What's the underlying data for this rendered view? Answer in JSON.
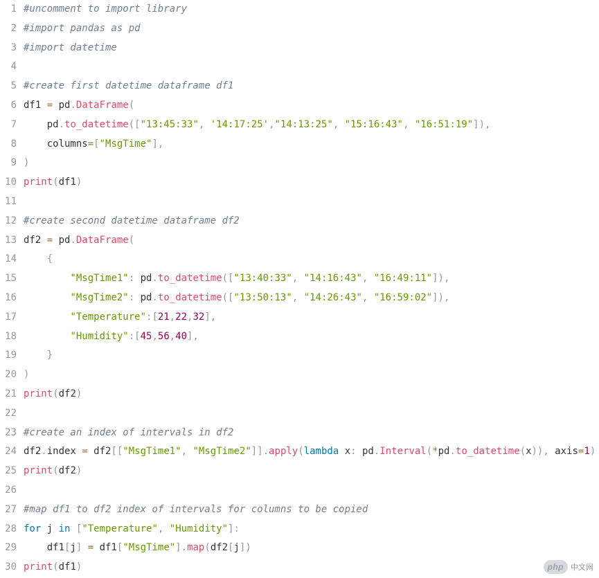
{
  "code": {
    "lines": [
      {
        "n": 1,
        "tokens": [
          {
            "c": "comment",
            "t": "#uncomment to import library"
          }
        ]
      },
      {
        "n": 2,
        "tokens": [
          {
            "c": "comment",
            "t": "#import pandas as pd"
          }
        ]
      },
      {
        "n": 3,
        "tokens": [
          {
            "c": "comment",
            "t": "#import datetime"
          }
        ]
      },
      {
        "n": 4,
        "tokens": [
          {
            "c": "ident",
            "t": " "
          }
        ]
      },
      {
        "n": 5,
        "tokens": [
          {
            "c": "comment",
            "t": "#create first datetime dataframe df1"
          }
        ]
      },
      {
        "n": 6,
        "tokens": [
          {
            "c": "ident",
            "t": "df1 "
          },
          {
            "c": "op",
            "t": "="
          },
          {
            "c": "ident",
            "t": " pd"
          },
          {
            "c": "punct",
            "t": "."
          },
          {
            "c": "call",
            "t": "DataFrame"
          },
          {
            "c": "punct",
            "t": "("
          }
        ]
      },
      {
        "n": 7,
        "tokens": [
          {
            "c": "ident",
            "t": "    pd"
          },
          {
            "c": "punct",
            "t": "."
          },
          {
            "c": "call",
            "t": "to_datetime"
          },
          {
            "c": "punct",
            "t": "(["
          },
          {
            "c": "string",
            "t": "\"13:45:33\""
          },
          {
            "c": "punct",
            "t": ","
          },
          {
            "c": "ident",
            "t": " "
          },
          {
            "c": "string",
            "t": "'14:17:25'"
          },
          {
            "c": "punct",
            "t": ","
          },
          {
            "c": "string",
            "t": "\"14:13:25\""
          },
          {
            "c": "punct",
            "t": ","
          },
          {
            "c": "ident",
            "t": " "
          },
          {
            "c": "string",
            "t": "\"15:16:43\""
          },
          {
            "c": "punct",
            "t": ","
          },
          {
            "c": "ident",
            "t": " "
          },
          {
            "c": "string",
            "t": "\"16:51:19\""
          },
          {
            "c": "punct",
            "t": "]),"
          }
        ]
      },
      {
        "n": 8,
        "tokens": [
          {
            "c": "ident",
            "t": "    columns"
          },
          {
            "c": "op",
            "t": "="
          },
          {
            "c": "punct",
            "t": "["
          },
          {
            "c": "string",
            "t": "\"MsgTime\""
          },
          {
            "c": "punct",
            "t": "],"
          }
        ]
      },
      {
        "n": 9,
        "tokens": [
          {
            "c": "punct",
            "t": ")"
          }
        ]
      },
      {
        "n": 10,
        "tokens": [
          {
            "c": "call",
            "t": "print"
          },
          {
            "c": "punct",
            "t": "("
          },
          {
            "c": "ident",
            "t": "df1"
          },
          {
            "c": "punct",
            "t": ")"
          }
        ]
      },
      {
        "n": 11,
        "tokens": [
          {
            "c": "ident",
            "t": " "
          }
        ]
      },
      {
        "n": 12,
        "tokens": [
          {
            "c": "comment",
            "t": "#create second datetime dataframe df2"
          }
        ]
      },
      {
        "n": 13,
        "tokens": [
          {
            "c": "ident",
            "t": "df2 "
          },
          {
            "c": "op",
            "t": "="
          },
          {
            "c": "ident",
            "t": " pd"
          },
          {
            "c": "punct",
            "t": "."
          },
          {
            "c": "call",
            "t": "DataFrame"
          },
          {
            "c": "punct",
            "t": "("
          }
        ]
      },
      {
        "n": 14,
        "tokens": [
          {
            "c": "ident",
            "t": "    "
          },
          {
            "c": "punct",
            "t": "{"
          }
        ]
      },
      {
        "n": 15,
        "tokens": [
          {
            "c": "ident",
            "t": "        "
          },
          {
            "c": "string",
            "t": "\"MsgTime1\""
          },
          {
            "c": "punct",
            "t": ":"
          },
          {
            "c": "ident",
            "t": " pd"
          },
          {
            "c": "punct",
            "t": "."
          },
          {
            "c": "call",
            "t": "to_datetime"
          },
          {
            "c": "punct",
            "t": "(["
          },
          {
            "c": "string",
            "t": "\"13:40:33\""
          },
          {
            "c": "punct",
            "t": ","
          },
          {
            "c": "ident",
            "t": " "
          },
          {
            "c": "string",
            "t": "\"14:16:43\""
          },
          {
            "c": "punct",
            "t": ","
          },
          {
            "c": "ident",
            "t": " "
          },
          {
            "c": "string",
            "t": "\"16:49:11\""
          },
          {
            "c": "punct",
            "t": "]),"
          }
        ]
      },
      {
        "n": 16,
        "tokens": [
          {
            "c": "ident",
            "t": "        "
          },
          {
            "c": "string",
            "t": "\"MsgTime2\""
          },
          {
            "c": "punct",
            "t": ":"
          },
          {
            "c": "ident",
            "t": " pd"
          },
          {
            "c": "punct",
            "t": "."
          },
          {
            "c": "call",
            "t": "to_datetime"
          },
          {
            "c": "punct",
            "t": "(["
          },
          {
            "c": "string",
            "t": "\"13:50:13\""
          },
          {
            "c": "punct",
            "t": ","
          },
          {
            "c": "ident",
            "t": " "
          },
          {
            "c": "string",
            "t": "\"14:26:43\""
          },
          {
            "c": "punct",
            "t": ","
          },
          {
            "c": "ident",
            "t": " "
          },
          {
            "c": "string",
            "t": "\"16:59:02\""
          },
          {
            "c": "punct",
            "t": "]),"
          }
        ]
      },
      {
        "n": 17,
        "tokens": [
          {
            "c": "ident",
            "t": "        "
          },
          {
            "c": "string",
            "t": "\"Temperature\""
          },
          {
            "c": "punct",
            "t": ":["
          },
          {
            "c": "number",
            "t": "21"
          },
          {
            "c": "punct",
            "t": ","
          },
          {
            "c": "number",
            "t": "22"
          },
          {
            "c": "punct",
            "t": ","
          },
          {
            "c": "number",
            "t": "32"
          },
          {
            "c": "punct",
            "t": "],"
          }
        ]
      },
      {
        "n": 18,
        "tokens": [
          {
            "c": "ident",
            "t": "        "
          },
          {
            "c": "string",
            "t": "\"Humidity\""
          },
          {
            "c": "punct",
            "t": ":["
          },
          {
            "c": "number",
            "t": "45"
          },
          {
            "c": "punct",
            "t": ","
          },
          {
            "c": "number",
            "t": "56"
          },
          {
            "c": "punct",
            "t": ","
          },
          {
            "c": "number",
            "t": "40"
          },
          {
            "c": "punct",
            "t": "],"
          }
        ]
      },
      {
        "n": 19,
        "tokens": [
          {
            "c": "ident",
            "t": "    "
          },
          {
            "c": "punct",
            "t": "}"
          }
        ]
      },
      {
        "n": 20,
        "tokens": [
          {
            "c": "punct",
            "t": ")"
          }
        ]
      },
      {
        "n": 21,
        "tokens": [
          {
            "c": "call",
            "t": "print"
          },
          {
            "c": "punct",
            "t": "("
          },
          {
            "c": "ident",
            "t": "df2"
          },
          {
            "c": "punct",
            "t": ")"
          }
        ]
      },
      {
        "n": 22,
        "tokens": [
          {
            "c": "ident",
            "t": " "
          }
        ]
      },
      {
        "n": 23,
        "tokens": [
          {
            "c": "comment",
            "t": "#create an index of intervals in df2"
          }
        ]
      },
      {
        "n": 24,
        "tokens": [
          {
            "c": "ident",
            "t": "df2"
          },
          {
            "c": "punct",
            "t": "."
          },
          {
            "c": "ident",
            "t": "index "
          },
          {
            "c": "op",
            "t": "="
          },
          {
            "c": "ident",
            "t": " df2"
          },
          {
            "c": "punct",
            "t": "[["
          },
          {
            "c": "string",
            "t": "\"MsgTime1\""
          },
          {
            "c": "punct",
            "t": ","
          },
          {
            "c": "ident",
            "t": " "
          },
          {
            "c": "string",
            "t": "\"MsgTime2\""
          },
          {
            "c": "punct",
            "t": "]]."
          },
          {
            "c": "call",
            "t": "apply"
          },
          {
            "c": "punct",
            "t": "("
          },
          {
            "c": "keyword",
            "t": "lambda"
          },
          {
            "c": "ident",
            "t": " x"
          },
          {
            "c": "punct",
            "t": ":"
          },
          {
            "c": "ident",
            "t": " pd"
          },
          {
            "c": "punct",
            "t": "."
          },
          {
            "c": "call",
            "t": "Interval"
          },
          {
            "c": "punct",
            "t": "("
          },
          {
            "c": "op",
            "t": "*"
          },
          {
            "c": "ident",
            "t": "pd"
          },
          {
            "c": "punct",
            "t": "."
          },
          {
            "c": "call",
            "t": "to_datetime"
          },
          {
            "c": "punct",
            "t": "("
          },
          {
            "c": "ident",
            "t": "x"
          },
          {
            "c": "punct",
            "t": ")),"
          },
          {
            "c": "ident",
            "t": " axis"
          },
          {
            "c": "op",
            "t": "="
          },
          {
            "c": "number",
            "t": "1"
          },
          {
            "c": "punct",
            "t": ")"
          }
        ]
      },
      {
        "n": 25,
        "tokens": [
          {
            "c": "call",
            "t": "print"
          },
          {
            "c": "punct",
            "t": "("
          },
          {
            "c": "ident",
            "t": "df2"
          },
          {
            "c": "punct",
            "t": ")"
          }
        ]
      },
      {
        "n": 26,
        "tokens": [
          {
            "c": "ident",
            "t": " "
          }
        ]
      },
      {
        "n": 27,
        "tokens": [
          {
            "c": "comment",
            "t": "#map df1 to df2 index of intervals for columns to be copied"
          }
        ]
      },
      {
        "n": 28,
        "tokens": [
          {
            "c": "keyword",
            "t": "for"
          },
          {
            "c": "ident",
            "t": " j "
          },
          {
            "c": "keyword",
            "t": "in"
          },
          {
            "c": "ident",
            "t": " "
          },
          {
            "c": "punct",
            "t": "["
          },
          {
            "c": "string",
            "t": "\"Temperature\""
          },
          {
            "c": "punct",
            "t": ","
          },
          {
            "c": "ident",
            "t": " "
          },
          {
            "c": "string",
            "t": "\"Humidity\""
          },
          {
            "c": "punct",
            "t": "]:"
          }
        ]
      },
      {
        "n": 29,
        "tokens": [
          {
            "c": "ident",
            "t": "    df1"
          },
          {
            "c": "punct",
            "t": "["
          },
          {
            "c": "ident",
            "t": "j"
          },
          {
            "c": "punct",
            "t": "]"
          },
          {
            "c": "ident",
            "t": " "
          },
          {
            "c": "op",
            "t": "="
          },
          {
            "c": "ident",
            "t": " df1"
          },
          {
            "c": "punct",
            "t": "["
          },
          {
            "c": "string",
            "t": "\"MsgTime\""
          },
          {
            "c": "punct",
            "t": "]."
          },
          {
            "c": "call",
            "t": "map"
          },
          {
            "c": "punct",
            "t": "("
          },
          {
            "c": "ident",
            "t": "df2"
          },
          {
            "c": "punct",
            "t": "["
          },
          {
            "c": "ident",
            "t": "j"
          },
          {
            "c": "punct",
            "t": "])"
          }
        ]
      },
      {
        "n": 30,
        "tokens": [
          {
            "c": "call",
            "t": "print"
          },
          {
            "c": "punct",
            "t": "("
          },
          {
            "c": "ident",
            "t": "df1"
          },
          {
            "c": "punct",
            "t": ")"
          }
        ]
      }
    ]
  },
  "watermark": {
    "badge": "php",
    "text": "中文网"
  }
}
